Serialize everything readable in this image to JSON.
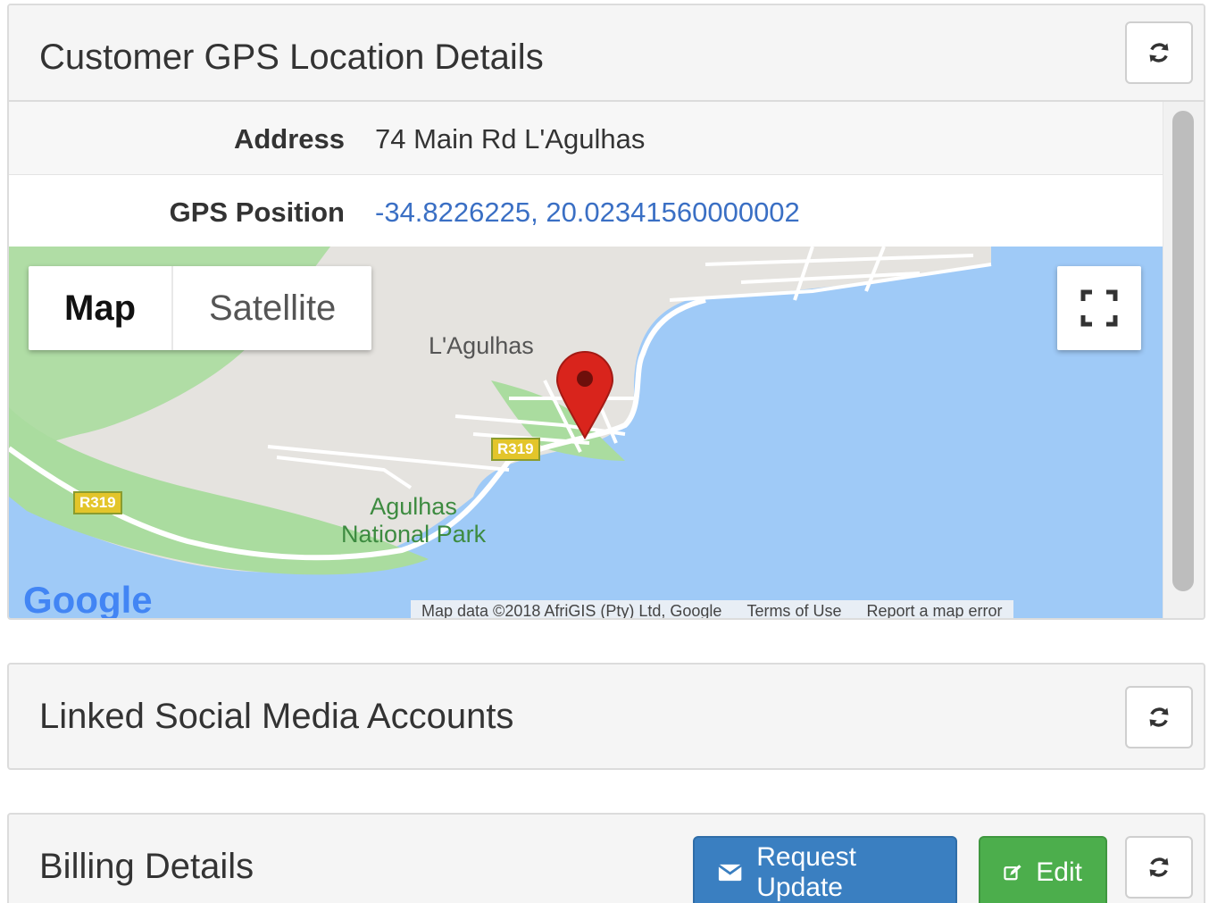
{
  "gps_panel": {
    "title": "Customer GPS Location Details",
    "refresh_icon": "refresh-icon",
    "rows": [
      {
        "label": "Address",
        "value": "74 Main Rd L'Agulhas"
      },
      {
        "label": "GPS Position",
        "value": "-34.8226225, 20.02341560000002"
      }
    ],
    "link_color": "#3a6fc4",
    "map": {
      "type_control": {
        "map": "Map",
        "satellite": "Satellite",
        "selected": "Map"
      },
      "fullscreen_icon": "fullscreen-icon",
      "town_label": "L'Agulhas",
      "park_label_line1": "Agulhas",
      "park_label_line2": "National Park",
      "road_label_1": "R319",
      "road_label_2": "R319",
      "marker_icon": "map-pin-icon",
      "logo": "Google",
      "attribution": "Map data ©2018 AfriGIS (Pty) Ltd, Google",
      "terms": "Terms of Use",
      "report": "Report a map error",
      "water_color": "#9fcaf7",
      "land_color": "#e5e3df",
      "park_color": "#aadc9f",
      "marker_color": "#d9241c"
    }
  },
  "social_panel": {
    "title": "Linked Social Media Accounts",
    "refresh_icon": "refresh-icon"
  },
  "billing_panel": {
    "title": "Billing Details",
    "request_update_label": "Request Update",
    "request_update_icon": "envelope-icon",
    "edit_label": "Edit",
    "edit_icon": "edit-icon",
    "refresh_icon": "refresh-icon",
    "primary_color": "#3a7fc1",
    "success_color": "#4cae4c"
  }
}
